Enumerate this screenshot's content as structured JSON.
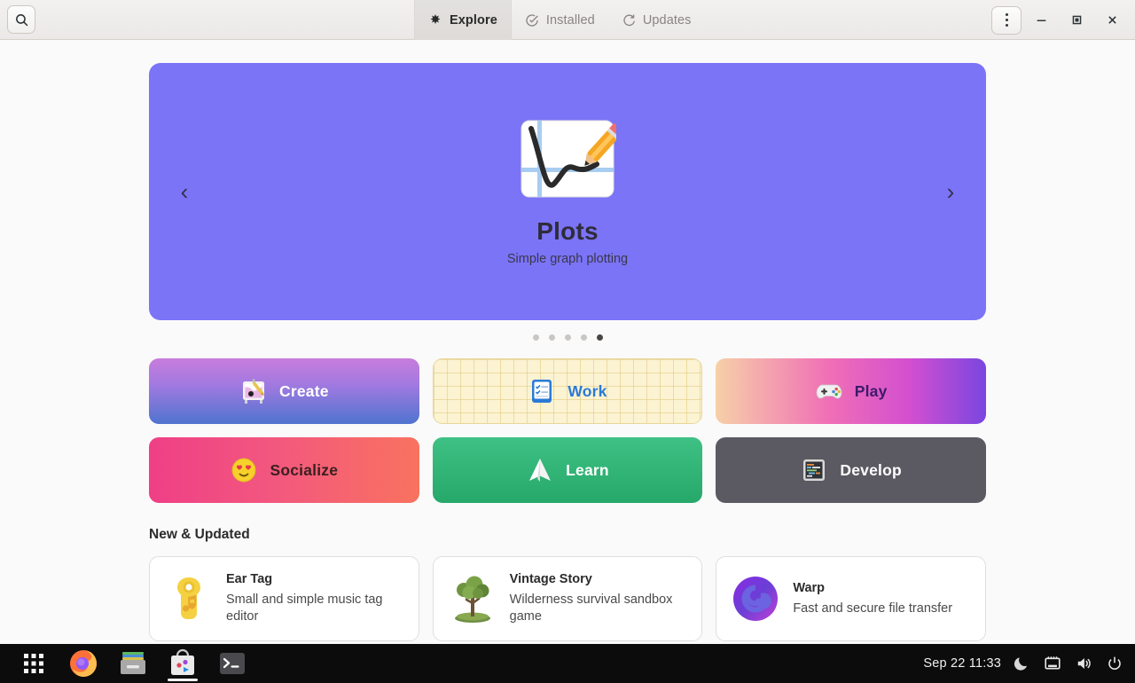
{
  "window": {
    "search_button": "search-icon",
    "menu_button": "menu-icon",
    "minimize": "minimize-icon",
    "maximize": "maximize-icon",
    "close": "close-icon",
    "tabs": [
      {
        "label": "Explore",
        "icon": "explore-star-icon",
        "active": true
      },
      {
        "label": "Installed",
        "icon": "check-circle-icon",
        "active": false
      },
      {
        "label": "Updates",
        "icon": "refresh-icon",
        "active": false
      }
    ]
  },
  "banner": {
    "app_title": "Plots",
    "app_subtitle": "Simple graph plotting",
    "background_color": "#7b74f7",
    "prev_arrow": "‹",
    "next_arrow": "›",
    "dots_total": 5,
    "dots_active_index": 5
  },
  "categories": [
    {
      "label": "Create",
      "icon": "easel-icon",
      "accent": "#a279e0"
    },
    {
      "label": "Work",
      "icon": "checklist-icon",
      "accent": "#2b7ad6"
    },
    {
      "label": "Play",
      "icon": "gamepad-icon",
      "accent": "#d24fd0"
    },
    {
      "label": "Socialize",
      "icon": "heart-eyes-emoji-icon",
      "accent": "#f2577f"
    },
    {
      "label": "Learn",
      "icon": "paper-plane-icon",
      "accent": "#25a869"
    },
    {
      "label": "Develop",
      "icon": "code-terminal-icon",
      "accent": "#5b5a62"
    }
  ],
  "new_and_updated": {
    "heading": "New & Updated",
    "apps": [
      {
        "name": "Ear Tag",
        "description": "Small and simple music tag editor",
        "icon": "ear-tag-icon"
      },
      {
        "name": "Vintage Story",
        "description": "Wilderness survival sandbox game",
        "icon": "tree-icon"
      },
      {
        "name": "Warp",
        "description": "Fast and secure file transfer",
        "icon": "spiral-icon"
      }
    ]
  },
  "taskbar": {
    "apps": [
      {
        "name": "show-applications",
        "icon": "grid-dots-icon",
        "running": false
      },
      {
        "name": "firefox",
        "icon": "firefox-icon",
        "running": false
      },
      {
        "name": "files",
        "icon": "file-manager-icon",
        "running": false
      },
      {
        "name": "software",
        "icon": "software-bag-icon",
        "running": true
      },
      {
        "name": "terminal",
        "icon": "terminal-icon",
        "running": false
      }
    ],
    "clock": "Sep 22  11:33",
    "tray": [
      {
        "name": "night-light",
        "icon": "moon-icon"
      },
      {
        "name": "network",
        "icon": "network-icon"
      },
      {
        "name": "volume",
        "icon": "speaker-icon"
      },
      {
        "name": "power",
        "icon": "power-icon"
      }
    ]
  }
}
